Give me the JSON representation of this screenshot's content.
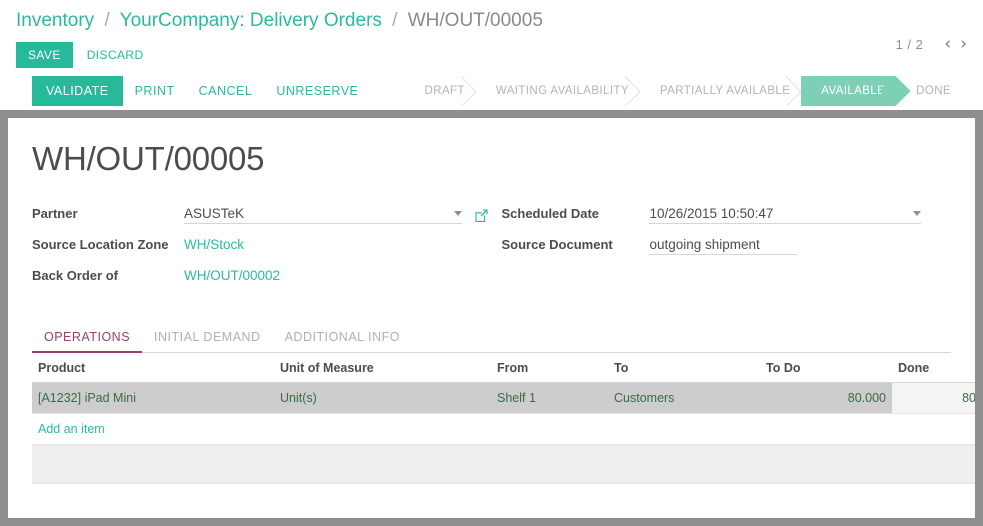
{
  "breadcrumb": {
    "items": [
      {
        "label": "Inventory",
        "type": "link"
      },
      {
        "label": "YourCompany: Delivery Orders",
        "type": "link"
      },
      {
        "label": "WH/OUT/00005",
        "type": "current"
      }
    ],
    "separator": "/"
  },
  "editbar": {
    "save_label": "SAVE",
    "discard_label": "DISCARD"
  },
  "pager": {
    "count": "1 / 2",
    "prev_icon": "chevron-left-icon",
    "next_icon": "chevron-right-icon",
    "prev_glyph": "‹",
    "next_glyph": "›"
  },
  "actions": {
    "primary": "VALIDATE",
    "buttons": [
      "PRINT",
      "CANCEL",
      "UNRESERVE"
    ]
  },
  "statusbar": {
    "stages": [
      {
        "label": "DRAFT",
        "active": false
      },
      {
        "label": "WAITING AVAILABILITY",
        "active": false
      },
      {
        "label": "PARTIALLY AVAILABLE",
        "active": false
      },
      {
        "label": "AVAILABLE",
        "active": true
      },
      {
        "label": "DONE",
        "active": false
      }
    ]
  },
  "record": {
    "title": "WH/OUT/00005",
    "fields_left": [
      {
        "label": "Partner",
        "value": "ASUSTeK",
        "kind": "input"
      },
      {
        "label": "Source Location Zone",
        "value": "WH/Stock",
        "kind": "link"
      },
      {
        "label": "Back Order of",
        "value": "WH/OUT/00002",
        "kind": "link"
      }
    ],
    "fields_right": [
      {
        "label": "Scheduled Date",
        "value": "10/26/2015 10:50:47",
        "kind": "input"
      },
      {
        "label": "Source Document",
        "value": "outgoing shipment",
        "kind": "input"
      }
    ]
  },
  "tabs": [
    {
      "label": "OPERATIONS",
      "active": true
    },
    {
      "label": "INITIAL DEMAND",
      "active": false
    },
    {
      "label": "ADDITIONAL INFO",
      "active": false
    }
  ],
  "table": {
    "columns": [
      "Product",
      "Unit of Measure",
      "From",
      "To",
      "To Do",
      "Done"
    ],
    "rows": [
      {
        "product": "[A1232] iPad Mini",
        "uom": "Unit(s)",
        "from": "Shelf 1",
        "to": "Customers",
        "to_do": "80.000",
        "done": "80",
        "selected": true,
        "edit_icon": "pencil-icon",
        "delete_icon": "trash-icon"
      }
    ],
    "add_item_label": "Add an item"
  },
  "colors": {
    "brand_teal": "#26b99a",
    "stage_active": "#7dcfb6",
    "tab_active": "#9b3d72",
    "page_backdrop": "#8f8f8f",
    "row_selected": "#cdcdcd",
    "cell_value_green": "#3a6b46"
  }
}
